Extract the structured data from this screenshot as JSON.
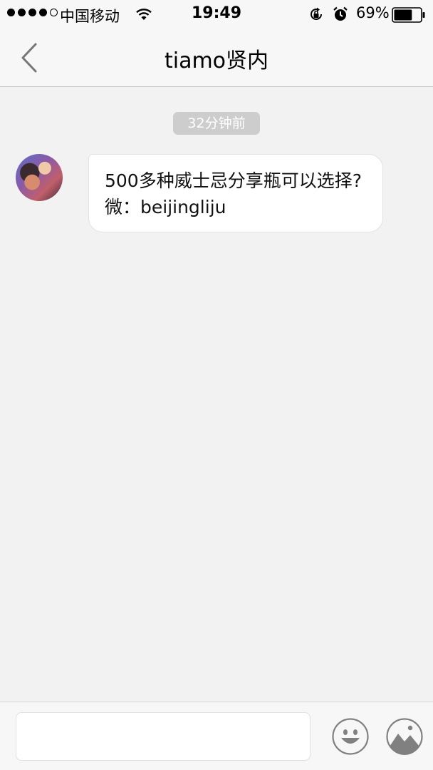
{
  "status_bar": {
    "carrier": "中国移动",
    "time": "19:49",
    "battery_percent": "69%",
    "battery_level": 0.69,
    "icons": [
      "wifi-icon",
      "rotation-lock-icon",
      "alarm-icon",
      "battery-icon"
    ]
  },
  "nav": {
    "title": "tiamo贤内",
    "back_icon": "chevron-left-icon"
  },
  "chat": {
    "timestamp": "32分钟前",
    "messages": [
      {
        "sender": "other",
        "text": "500多种威士忌分享瓶可以选择?微：beijingliju"
      }
    ]
  },
  "input_bar": {
    "placeholder": "",
    "value": "",
    "emoji_icon": "smiley-icon",
    "image_icon": "image-icon"
  },
  "colors": {
    "background": "#f2f2f2",
    "bar": "#f7f7f7",
    "timestamp_bg": "#cdcdcd",
    "bubble_bg": "#ffffff",
    "icon_gray": "#808080"
  }
}
